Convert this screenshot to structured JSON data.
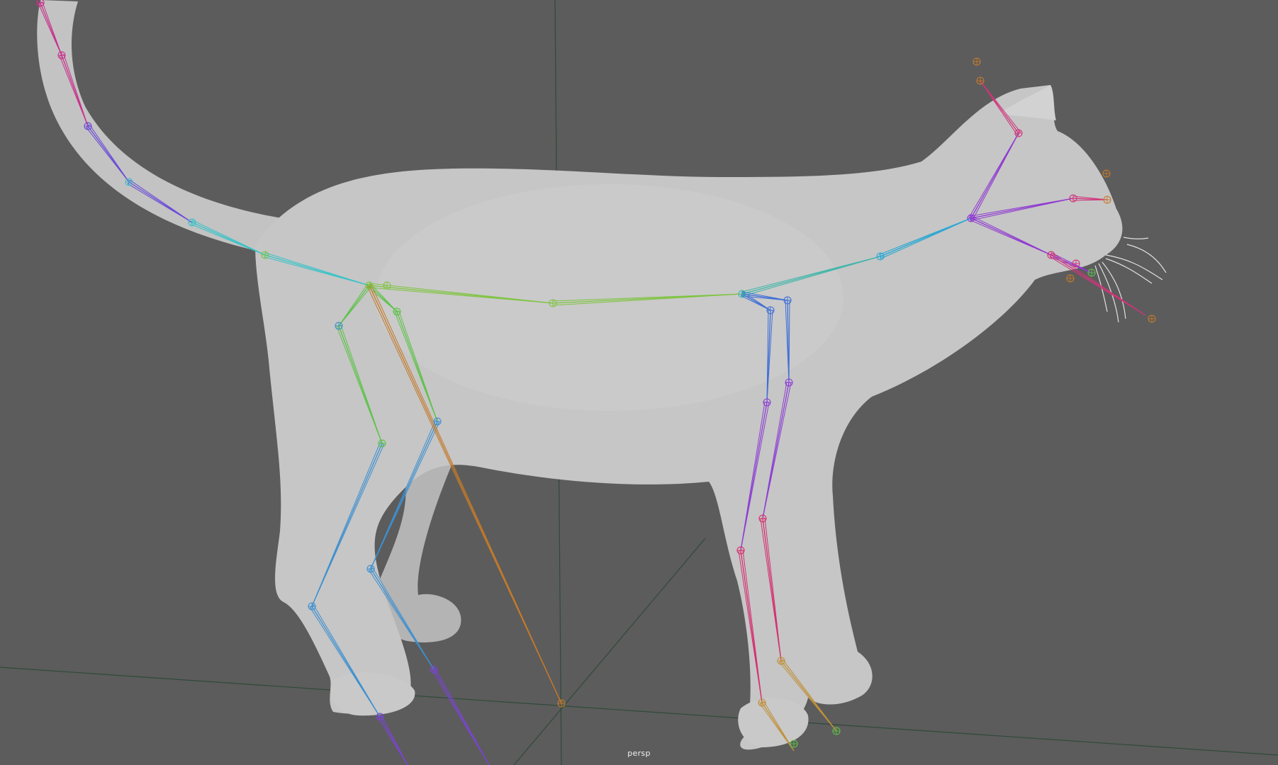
{
  "viewport": {
    "camera_label": "persp",
    "background": "#5c5c5c",
    "grid_color": "#2f4a38",
    "mesh_color": "#c2c2c2"
  },
  "skeleton_colors": {
    "tail_tip": "#c8318c",
    "tail_mid": "#6a4ad6",
    "tail_base": "#39c3c8",
    "spine_back": "#7fc441",
    "spine_front": "#3fb6a9",
    "hind_leg_upper": "#5ec24a",
    "hind_leg_lower": "#3d8fcf",
    "hind_foot": "#7a45d0",
    "front_leg_upper": "#3f6fd6",
    "front_leg_mid": "#8d3fd3",
    "front_leg_lower": "#d4306f",
    "front_foot": "#c0903a",
    "neck": "#2fa7d6",
    "head": "#8f3ad1",
    "ears": "#d0357a",
    "jaw": "#cf8a2a",
    "pole_vector": "#c47a2a"
  }
}
